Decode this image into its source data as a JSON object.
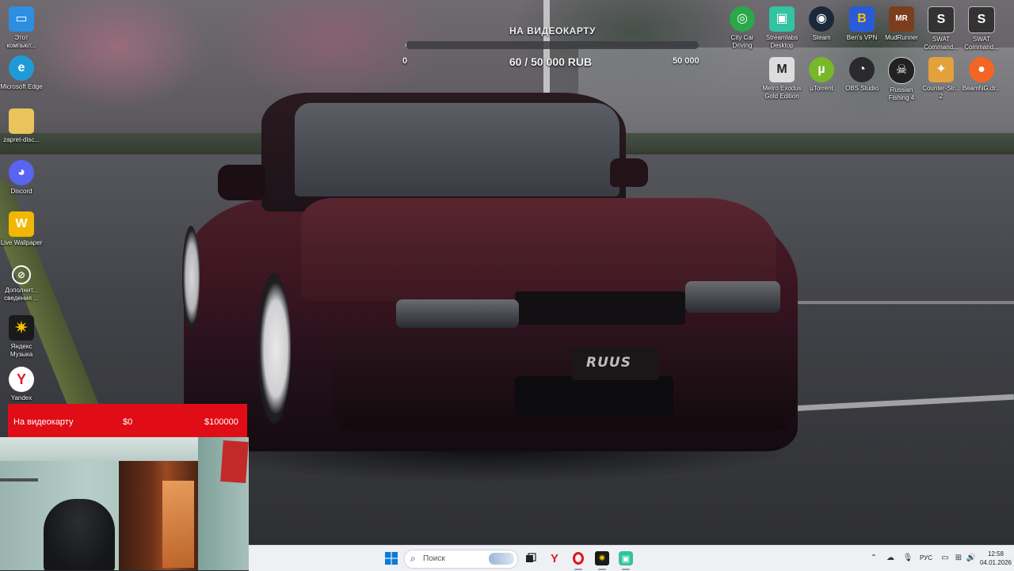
{
  "goal": {
    "title": "НА ВИДЕОКАРТУ",
    "min_label": "0",
    "max_label": "50 000",
    "progress_text": "60 / 50 000 RUB",
    "progress_fraction": 0.0012
  },
  "desktop_left": [
    {
      "label": "Этот компьют...",
      "icon": "this-pc-icon",
      "color": "#2e8fe0"
    },
    {
      "label": "Microsoft Edge",
      "icon": "edge-icon",
      "color": "#1e9bd7"
    },
    {
      "label": "zapret-disc...",
      "icon": "folder-icon",
      "color": "#e8c45a"
    },
    {
      "label": "Discord",
      "icon": "discord-icon",
      "color": "#5865f2"
    },
    {
      "label": "Live Wallpaper",
      "icon": "live-wallpaper-icon",
      "color": "#f2b705"
    },
    {
      "label": "Дополнит... сведения ...",
      "icon": "info-icon",
      "color": "#3a3a3a"
    },
    {
      "label": "Яндекс Музыка",
      "icon": "yandex-music-icon",
      "color": "#1a1a1a"
    },
    {
      "label": "Yandex",
      "icon": "yandex-browser-icon",
      "color": "#ffffff"
    }
  ],
  "desktop_top_row": [
    {
      "label": "City Car Driving",
      "icon": "city-car-driving-icon",
      "color": "#2aa84a"
    },
    {
      "label": "Streamlabs Desktop",
      "icon": "streamlabs-icon",
      "color": "#31c3a2"
    },
    {
      "label": "Steam",
      "icon": "steam-icon",
      "color": "#1b2838"
    },
    {
      "label": "Ben's VPN",
      "icon": "vpn-icon",
      "color": "#2a5bd7"
    },
    {
      "label": "MudRunner",
      "icon": "mudrunner-icon",
      "color": "#7a3e1d"
    },
    {
      "label": "SWAT Command...",
      "icon": "swat-icon",
      "color": "#333333"
    },
    {
      "label": "SWAT Command...",
      "icon": "swat-icon",
      "color": "#333333"
    }
  ],
  "desktop_second_row": [
    {
      "label": "Metro Exodus Gold Edition",
      "icon": "metro-exodus-icon",
      "color": "#dddddd"
    },
    {
      "label": "µTorrent",
      "icon": "utorrent-icon",
      "color": "#76b82a"
    },
    {
      "label": "OBS Studio",
      "icon": "obs-icon",
      "color": "#2a2a2e"
    },
    {
      "label": "Russian Fishing 4",
      "icon": "russian-fishing-icon",
      "color": "#222222"
    },
    {
      "label": "Counter-Str... 2",
      "icon": "counter-strike-icon",
      "color": "#e2a13a"
    },
    {
      "label": "BeamNG.dr...",
      "icon": "beamng-icon",
      "color": "#f26522"
    }
  ],
  "red_banner": {
    "label": "На видеокарту",
    "current": "$0",
    "target": "$100000"
  },
  "wallpaper": {
    "plate_text": "RUUS"
  },
  "taskbar": {
    "search_placeholder": "Поиск",
    "lang": "РУС",
    "time": "12:58",
    "date": "04.01.2026"
  },
  "colors": {
    "banner_red": "#e00d16",
    "taskbar_bg": "#eef0f4"
  }
}
